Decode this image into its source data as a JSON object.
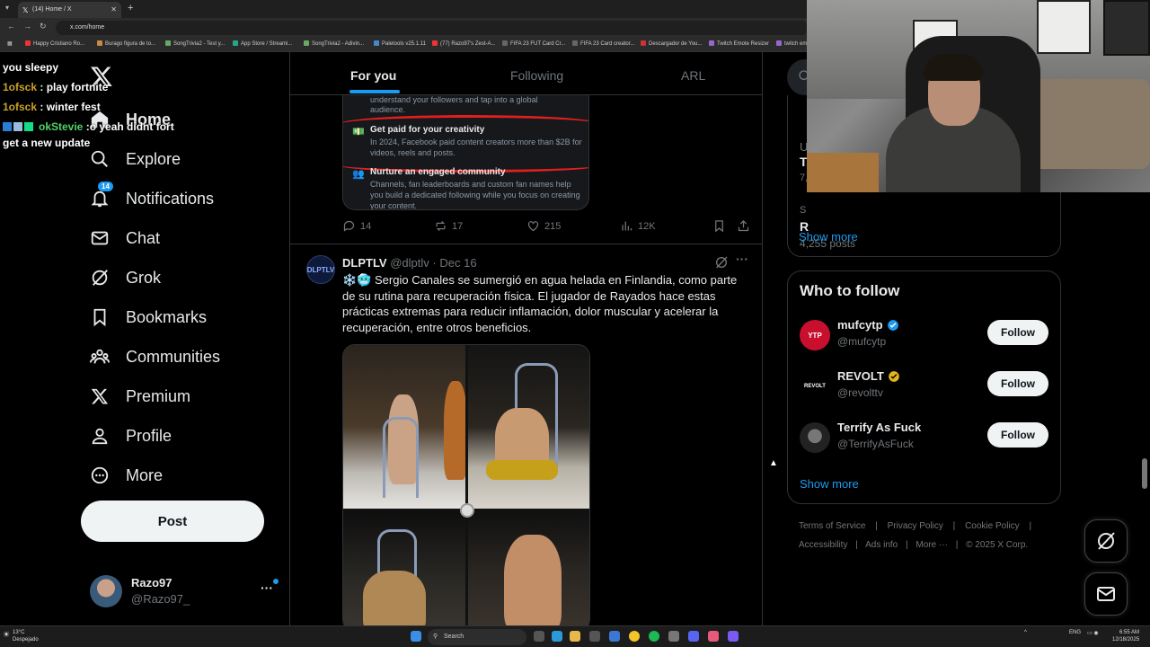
{
  "browser": {
    "tab_title": "(14) Home / X",
    "url": "x.com/home",
    "bookmarks": [
      "Happy Cristiano Ro...",
      "Burago figura de to...",
      "SongTrivia2 - Test y...",
      "App Store / Streami...",
      "SongTrivia2 - Adivin...",
      "Paletools v25.1.11",
      "(77) Razo97's Zest-A...",
      "FIFA 23 FUT Card Cr...",
      "FIFA 23 Card creator...",
      "Descargador de You...",
      "Twitch Emote Resizer",
      "twitch em"
    ]
  },
  "chat_overlay": [
    {
      "user": "",
      "message": "you sleepy"
    },
    {
      "user": "1ofsck",
      "message": ": play fortnite"
    },
    {
      "user": "1ofsck",
      "message": ": winter fest"
    },
    {
      "user": "okStevie",
      "message": ":o yeah didnt fort get a new update"
    }
  ],
  "nav": {
    "items": [
      {
        "label": "Home",
        "icon": "home-icon"
      },
      {
        "label": "Explore",
        "icon": "search-icon"
      },
      {
        "label": "Notifications",
        "icon": "bell-icon",
        "badge": "14"
      },
      {
        "label": "Chat",
        "icon": "mail-icon"
      },
      {
        "label": "Grok",
        "icon": "grok-icon"
      },
      {
        "label": "Bookmarks",
        "icon": "bookmark-icon"
      },
      {
        "label": "Communities",
        "icon": "communities-icon"
      },
      {
        "label": "Premium",
        "icon": "x-logo-icon"
      },
      {
        "label": "Profile",
        "icon": "person-icon"
      },
      {
        "label": "More",
        "icon": "more-circle-icon"
      }
    ],
    "post_label": "Post",
    "account": {
      "name": "Razo97",
      "handle": "@Razo97_"
    }
  },
  "timeline": {
    "tabs": [
      "For you",
      "Following",
      "ARL"
    ],
    "active_tab": "For you",
    "prev_post": {
      "card": {
        "top_lines": [
          "understand your followers and tap into a global",
          "audience."
        ],
        "items": [
          {
            "title": "Get paid for your creativity",
            "text": "In 2024, Facebook paid content creators more than $2B for videos, reels and posts."
          },
          {
            "title": "Nurture an engaged community",
            "text": "Channels, fan leaderboards and custom fan names help you build a dedicated following while you focus on creating your content."
          }
        ]
      },
      "stats": {
        "replies": "14",
        "reposts": "17",
        "likes": "215",
        "views": "12K"
      }
    },
    "post": {
      "avatar_text": "DLPTLV",
      "name": "DLPTLV",
      "handle": "@dlptlv",
      "sep": "·",
      "date": "Dec 16",
      "emoji": "❄️🥶",
      "text": "Sergio Canales se sumergió en agua helada en Finlandia, como parte de su rutina para recuperación física. El jugador de Rayados hace estas prácticas extremas para reducir inflamación, dolor muscular y acelerar la recuperación, entre otros beneficios."
    }
  },
  "right": {
    "trends_clip": {
      "line1": "U",
      "line2": "T",
      "line3": "7,",
      "line4": "S",
      "line5": "R",
      "posts": "4,255 posts"
    },
    "show_more": "Show more",
    "who_to_follow": {
      "title": "Who to follow",
      "users": [
        {
          "name": "mufcytp",
          "handle": "@mufcytp",
          "verified": "blue",
          "avatar_text": "YTP"
        },
        {
          "name": "REVOLT",
          "handle": "@revolttv",
          "verified": "gold",
          "avatar_text": "REVOLT"
        },
        {
          "name": "Terrify As Fuck",
          "handle": "@TerrifyAsFuck",
          "verified": "",
          "avatar_text": ""
        }
      ],
      "follow_label": "Follow",
      "show_more": "Show more"
    },
    "footer": {
      "row1": [
        "Terms of Service",
        "Privacy Policy",
        "Cookie Policy"
      ],
      "row2": [
        "Accessibility",
        "Ads info",
        "More ···",
        "© 2025 X Corp."
      ]
    }
  },
  "taskbar": {
    "weather_temp": "13°C",
    "weather_desc": "Despejado",
    "search": "Search",
    "lang": "ENG",
    "time": "6:55 AM",
    "date": "12/18/2025"
  },
  "colors": {
    "accent": "#1d9bf0",
    "bg": "#000000",
    "border": "#2f3336",
    "muted": "#71767b"
  }
}
